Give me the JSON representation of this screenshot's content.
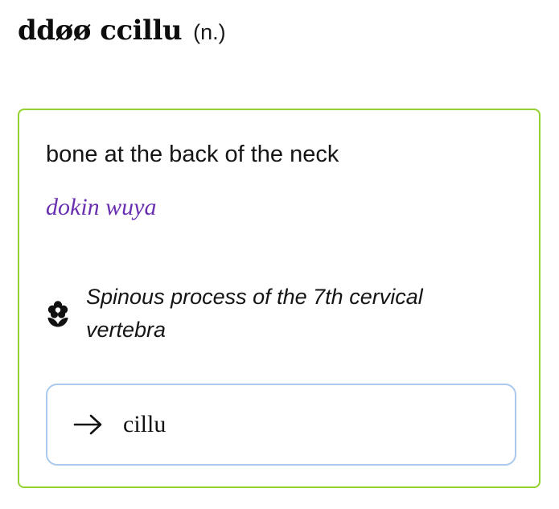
{
  "entry": {
    "headword": "ddøø ccillu",
    "part_of_speech": "(n.)"
  },
  "sense": {
    "gloss": "bone at the back of the neck",
    "translation": "dokin wuya",
    "scientific_name": "Spinous process of the 7th cervical vertebra",
    "scientific_icon": "flower-icon"
  },
  "cross_reference": {
    "icon": "arrow-right-icon",
    "target": "cillu"
  },
  "colors": {
    "card_border": "#92d12f",
    "translation_text": "#6a2fb0",
    "xref_border": "#a9c9ee"
  }
}
